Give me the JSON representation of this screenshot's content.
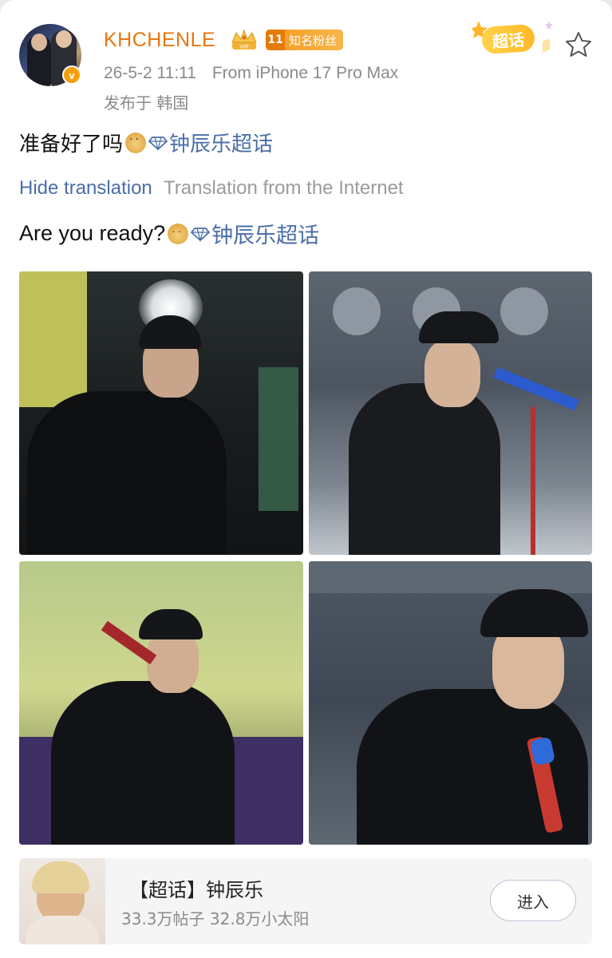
{
  "post": {
    "username": "KHCHENLE",
    "fan_badge": {
      "level": "11",
      "label": "知名粉丝"
    },
    "timestamp": "26-5-2 11:11",
    "source": "From iPhone 17 Pro Max",
    "location": "发布于 韩国",
    "super_topic_tag": "超话",
    "text_original": "准备好了吗",
    "topic_link": "钟辰乐超话",
    "translation_toggle": "Hide translation",
    "translation_source": "Translation from the Internet",
    "text_translated": "Are you ready?"
  },
  "topic_card": {
    "title": "【超话】钟辰乐",
    "stats": "33.3万帖子 32.8万小太阳",
    "enter_label": "进入"
  },
  "colors": {
    "username": "#e8760e",
    "link": "#4a6ea9",
    "badge": "#f59a1f",
    "super_topic": "#ffc13a"
  },
  "icons": [
    "verified-badge-icon",
    "crown-icon",
    "star-icon",
    "doge-emoji-icon",
    "super-topic-gem-icon"
  ]
}
